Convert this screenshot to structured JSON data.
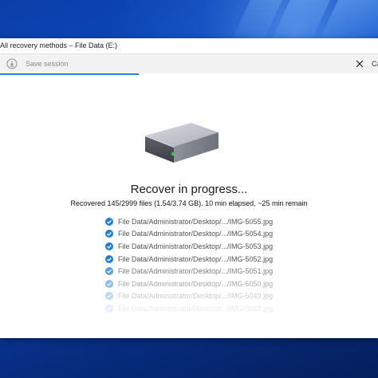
{
  "window": {
    "title": "All recovery methods – File Data (E:)"
  },
  "toolbar": {
    "save_label": "Save session",
    "cancel_label": "Ca"
  },
  "main": {
    "heading": "Recover in progress...",
    "status": "Recovered 145/2999 files (1.54/3.74 GB). 10 min elapsed, ~25 min remain",
    "files": [
      {
        "path": "File Data/Administrator/Desktop/.../IMG-5055.jpg"
      },
      {
        "path": "File Data/Administrator/Desktop/.../IMG-5054.jpg"
      },
      {
        "path": "File Data/Administrator/Desktop/.../IMG-5053.jpg"
      },
      {
        "path": "File Data/Administrator/Desktop/.../IMG-5052.jpg"
      },
      {
        "path": "File Data/Administrator/Desktop/.../IMG-5051.jpg"
      },
      {
        "path": "File Data/Administrator/Desktop/.../IMG-5050.jpg"
      },
      {
        "path": "File Data/Administrator/Desktop/.../IMG-5049.jpg"
      },
      {
        "path": "File Data/Administrator/Desktop/.../IMG-5048.jpg"
      }
    ]
  },
  "icons": {
    "save": "save-session-icon",
    "cancel": "close-icon",
    "drive": "hard-drive-icon",
    "check": "checkmark-circle-icon"
  },
  "colors": {
    "accent": "#1e7fd8",
    "progress": "#2a7fd4",
    "desktop": "#0a4fc7"
  }
}
